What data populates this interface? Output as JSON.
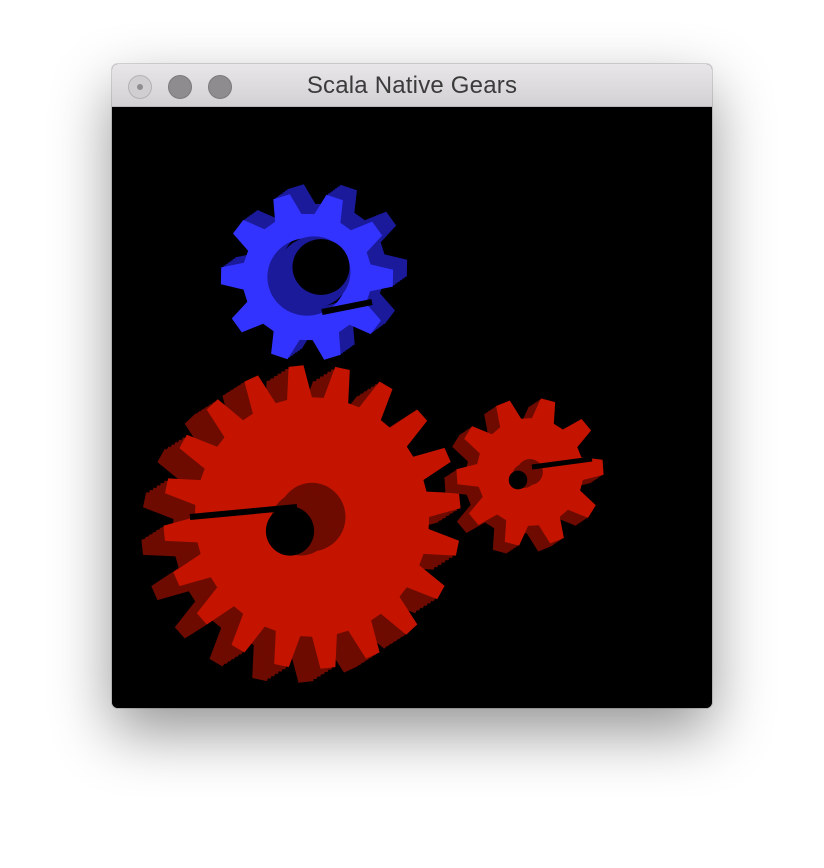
{
  "window": {
    "title": "Scala Native Gears"
  },
  "gears": [
    {
      "name": "large-gear",
      "color": "#c41400",
      "side_color": "#6e0b00",
      "teeth": 20
    },
    {
      "name": "small-gear",
      "color": "#c41400",
      "side_color": "#6e0b00",
      "teeth": 10
    },
    {
      "name": "blue-gear",
      "color": "#3333ff",
      "side_color": "#1a1a9a",
      "teeth": 10
    }
  ]
}
